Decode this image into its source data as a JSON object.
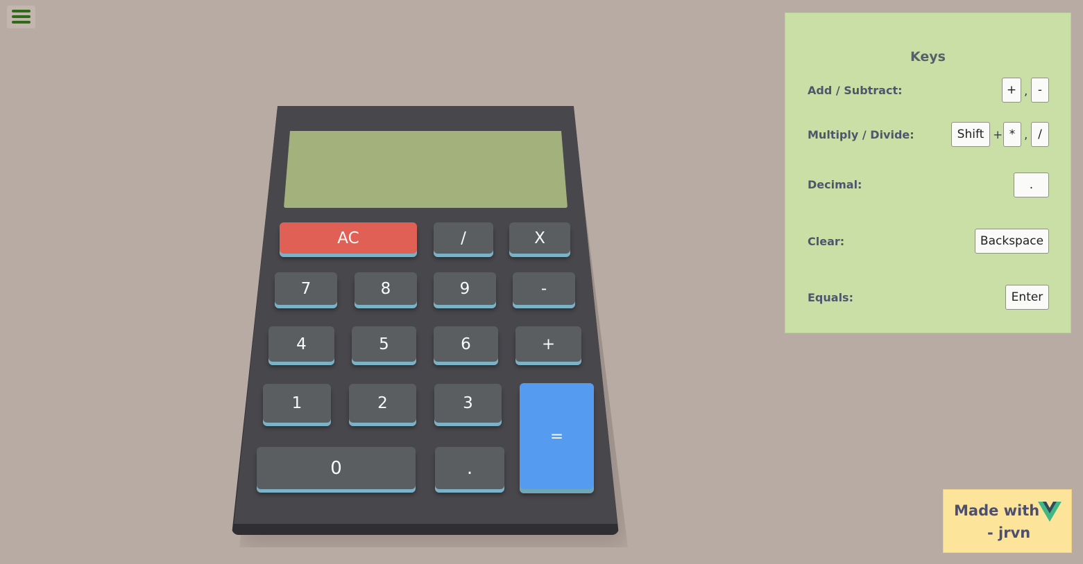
{
  "menu": {
    "icon": "hamburger-icon"
  },
  "calculator": {
    "display": "",
    "keys": {
      "ac": "AC",
      "divide": "/",
      "multiply": "X",
      "seven": "7",
      "eight": "8",
      "nine": "9",
      "minus": "-",
      "four": "4",
      "five": "5",
      "six": "6",
      "plus": "+",
      "one": "1",
      "two": "2",
      "three": "3",
      "equals": "=",
      "zero": "0",
      "decimal": "."
    },
    "colors": {
      "ac": "#e06055",
      "equals": "#559cf0",
      "key": "#5b5e60",
      "screen": "#a3b27c"
    }
  },
  "keys_panel": {
    "title": "Keys",
    "rows": [
      {
        "label": "Add / Subtract:",
        "keys": [
          "+",
          "-"
        ],
        "separators": [
          ","
        ]
      },
      {
        "label": "Multiply / Divide:",
        "keys": [
          "Shift",
          "*",
          "/"
        ],
        "separators": [
          "+",
          ","
        ]
      },
      {
        "label": "Decimal:",
        "keys": [
          "."
        ]
      },
      {
        "label": "Clear:",
        "keys": [
          "Backspace"
        ]
      },
      {
        "label": "Equals:",
        "keys": [
          "Enter"
        ]
      }
    ]
  },
  "badge": {
    "line1": "Made with",
    "line2": "- jrvn",
    "logo": "vue-logo-icon"
  }
}
